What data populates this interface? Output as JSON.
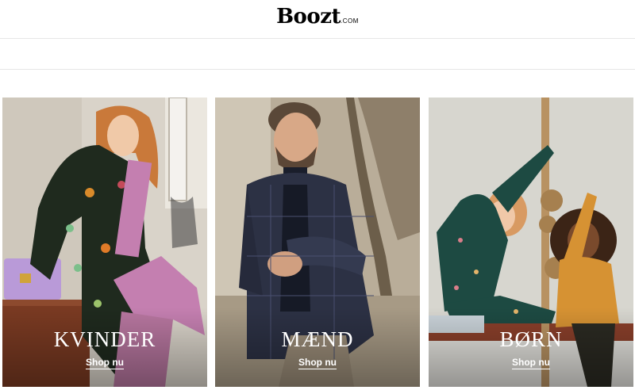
{
  "brand": {
    "name": "Boozt",
    "suffix": ".COM"
  },
  "categories": [
    {
      "title": "KVINDER",
      "cta": "Shop nu"
    },
    {
      "title": "MÆND",
      "cta": "Shop nu"
    },
    {
      "title": "BØRN",
      "cta": "Shop nu"
    }
  ],
  "colors": {
    "header_border": "#e6e6e6",
    "overlay_text": "#ffffff"
  }
}
